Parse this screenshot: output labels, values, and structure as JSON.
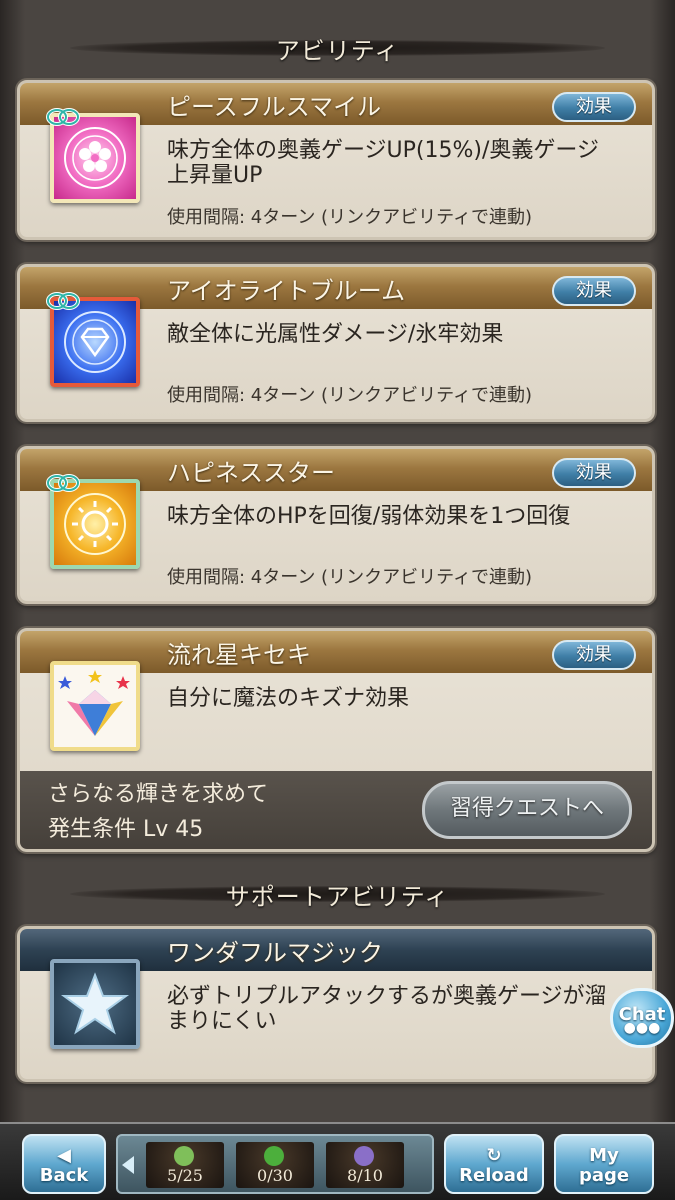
{
  "headers": {
    "ability": "アビリティ",
    "support": "サポートアビリティ"
  },
  "effect_label": "効果",
  "abilities": [
    {
      "name": "ピースフルスマイル",
      "desc": "味方全体の奥義ゲージUP(15%)/奥義ゲージ上昇量UP",
      "cooldown": "使用間隔: 4ターン (リンクアビリティで連動)",
      "icon": "pink-flower-icon"
    },
    {
      "name": "アイオライトブルーム",
      "desc": "敵全体に光属性ダメージ/氷牢効果",
      "cooldown": "使用間隔: 4ターン (リンクアビリティで連動)",
      "icon": "blue-gem-icon"
    },
    {
      "name": "ハピネススター",
      "desc": "味方全体のHPを回復/弱体効果を1つ回復",
      "cooldown": "使用間隔: 4ターン (リンクアビリティで連動)",
      "icon": "gold-sun-icon"
    },
    {
      "name": "流れ星キセキ",
      "desc": "自分に魔法のキズナ効果",
      "condition_title": "さらなる輝きを求めて",
      "condition_level": "発生条件 Lv 45",
      "quest_button": "習得クエストへ",
      "icon": "crown-star-icon"
    }
  ],
  "support": {
    "name": "ワンダフルマジック",
    "desc": "必ずトリプルアタックするが奥義ゲージが溜まりにくい",
    "icon": "star-icon"
  },
  "chat": "Chat",
  "nav": {
    "back": "Back",
    "reload": "Reload",
    "mypage_line1": "My",
    "mypage_line2": "page",
    "items": [
      {
        "count": "5/25",
        "color": "#7fbf5a"
      },
      {
        "count": "0/30",
        "color": "#4caf3c"
      },
      {
        "count": "8/10",
        "color": "#8a6fc8"
      }
    ]
  },
  "colors": {
    "ability_head": "#9c7740",
    "support_head": "#2e4253",
    "effect_button": "#3f7ea6"
  }
}
